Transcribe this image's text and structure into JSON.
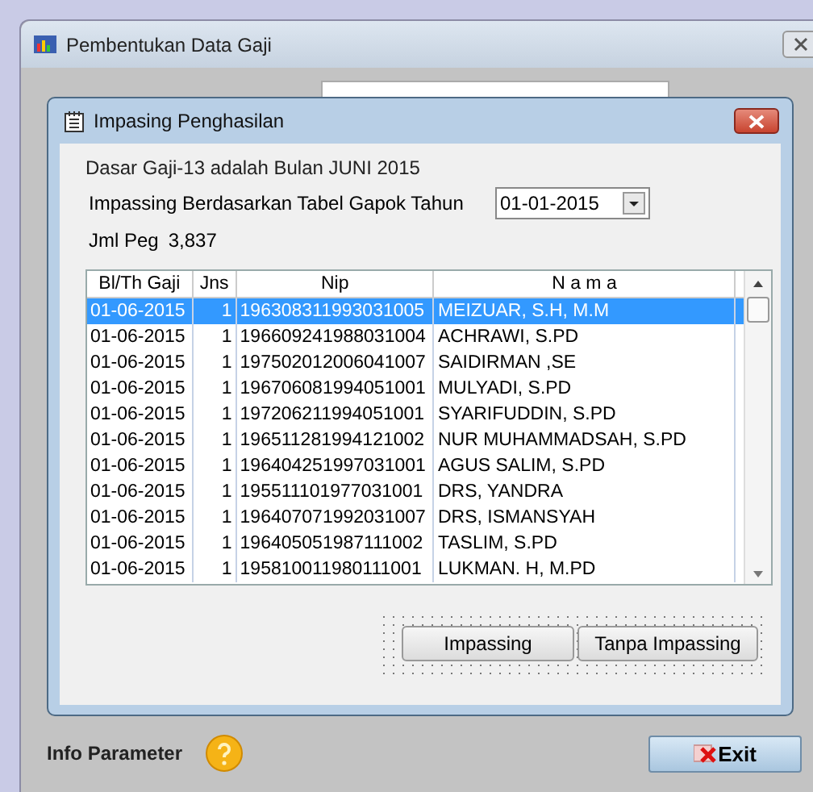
{
  "window": {
    "title": "Pembentukan Data Gaji"
  },
  "dialog": {
    "title": "Impasing Penghasilan",
    "info": "Dasar Gaji-13 adalah Bulan JUNI 2015",
    "year_label": "Impassing Berdasarkan Tabel Gapok Tahun",
    "year_value": "01-01-2015",
    "count_label": "Jml Peg",
    "count_value": "3,837",
    "table": {
      "columns": [
        "Bl/Th Gaji",
        "Jns",
        "Nip",
        "N a m a"
      ],
      "rows": [
        {
          "cells": [
            "01-06-2015",
            "1",
            "196308311993031005",
            "MEIZUAR, S.H, M.M"
          ],
          "selected": true
        },
        {
          "cells": [
            "01-06-2015",
            "1",
            "196609241988031004",
            "ACHRAWI, S.PD"
          ],
          "selected": false
        },
        {
          "cells": [
            "01-06-2015",
            "1",
            "197502012006041007",
            "SAIDIRMAN ,SE"
          ],
          "selected": false
        },
        {
          "cells": [
            "01-06-2015",
            "1",
            "196706081994051001",
            "MULYADI, S.PD"
          ],
          "selected": false
        },
        {
          "cells": [
            "01-06-2015",
            "1",
            "197206211994051001",
            "SYARIFUDDIN, S.PD"
          ],
          "selected": false
        },
        {
          "cells": [
            "01-06-2015",
            "1",
            "196511281994121002",
            "NUR MUHAMMADSAH, S.PD"
          ],
          "selected": false
        },
        {
          "cells": [
            "01-06-2015",
            "1",
            "196404251997031001",
            "AGUS SALIM, S.PD"
          ],
          "selected": false
        },
        {
          "cells": [
            "01-06-2015",
            "1",
            "195511101977031001",
            "DRS, YANDRA"
          ],
          "selected": false
        },
        {
          "cells": [
            "01-06-2015",
            "1",
            "196407071992031007",
            "DRS, ISMANSYAH"
          ],
          "selected": false
        },
        {
          "cells": [
            "01-06-2015",
            "1",
            "196405051987111002",
            "TASLIM, S.PD"
          ],
          "selected": false
        },
        {
          "cells": [
            "01-06-2015",
            "1",
            "195810011980111001",
            "LUKMAN. H,  M.PD"
          ],
          "selected": false
        }
      ]
    },
    "buttons": [
      "Impassing",
      "Tanpa Impassing"
    ]
  },
  "footer": {
    "info_label": "Info Parameter",
    "exit_button": "Exit"
  }
}
